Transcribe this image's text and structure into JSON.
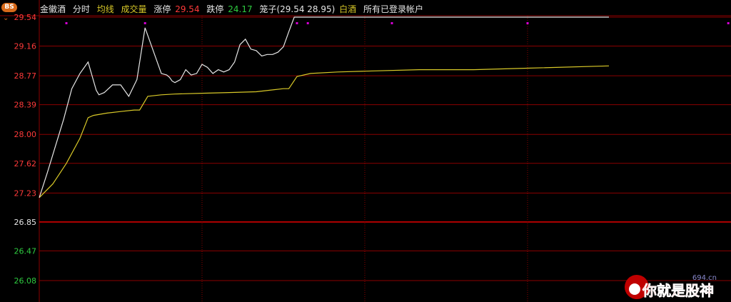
{
  "header": {
    "bs_badge": "BS",
    "stock_name": "金徽酒",
    "tab_timeshare": "分时",
    "tab_avg_line": "均线",
    "tab_volume": "成交量",
    "limit_up_label": "涨停",
    "limit_up_value": "29.54",
    "limit_down_label": "跌停",
    "limit_down_value": "24.17",
    "basket_text": "笼子(29.54 28.95)",
    "category": "白酒",
    "accounts_text": "所有已登录帐户"
  },
  "colors": {
    "background": "#000000",
    "grid": "#8b0000",
    "grid_center": "#b30000",
    "price_line": "#e6e6e6",
    "avg_line": "#d9c928",
    "up_text": "#ff3a3a",
    "down_text": "#2ecc40",
    "neutral_text": "#e6e6e6",
    "marker": "#d400d4"
  },
  "watermark": {
    "site": "694.cn",
    "text": "你就是股神"
  },
  "chart_data": {
    "type": "line",
    "ylim": [
      26.08,
      29.54
    ],
    "prev_close": 26.85,
    "y_ticks": [
      "29.54",
      "29.16",
      "28.77",
      "28.39",
      "28.00",
      "27.62",
      "27.23",
      "26.85",
      "26.47",
      "26.08"
    ],
    "session_minutes": 240,
    "series": [
      {
        "key": "price",
        "minutes": [
          0,
          3,
          6,
          9,
          12,
          15,
          18,
          21,
          22,
          24,
          27,
          30,
          33,
          36,
          39,
          42,
          45,
          47,
          48,
          49,
          50,
          52,
          54,
          56,
          58,
          60,
          62,
          64,
          66,
          68,
          70,
          72,
          74,
          76,
          78,
          80,
          82,
          84,
          86,
          88,
          90,
          92,
          94,
          95,
          96,
          97,
          98,
          99,
          100,
          101,
          102,
          103,
          104,
          105,
          106,
          107,
          108,
          210
        ],
        "values": [
          27.17,
          27.5,
          27.85,
          28.2,
          28.6,
          28.8,
          28.95,
          28.58,
          28.52,
          28.55,
          28.65,
          28.65,
          28.5,
          28.72,
          29.4,
          29.1,
          28.8,
          28.78,
          28.75,
          28.7,
          28.68,
          28.72,
          28.85,
          28.78,
          28.8,
          28.92,
          28.88,
          28.8,
          28.85,
          28.82,
          28.85,
          28.95,
          29.18,
          29.25,
          29.12,
          29.1,
          29.03,
          29.05,
          29.05,
          29.08,
          29.15,
          29.35,
          29.54,
          29.54,
          29.54,
          29.54,
          29.54,
          29.54,
          29.54,
          29.54,
          29.54,
          29.54,
          29.54,
          29.54,
          29.54,
          29.54,
          29.54,
          29.54
        ]
      },
      {
        "key": "average",
        "minutes": [
          0,
          5,
          10,
          15,
          18,
          20,
          25,
          30,
          35,
          37,
          40,
          45,
          50,
          60,
          70,
          80,
          90,
          92,
          95,
          100,
          110,
          120,
          140,
          160,
          180,
          210
        ],
        "values": [
          27.17,
          27.35,
          27.62,
          27.95,
          28.22,
          28.25,
          28.28,
          28.3,
          28.32,
          28.32,
          28.5,
          28.52,
          28.53,
          28.54,
          28.55,
          28.56,
          28.6,
          28.6,
          28.76,
          28.8,
          28.82,
          28.83,
          28.85,
          28.85,
          28.87,
          28.9
        ]
      }
    ],
    "markers": [
      10,
      39,
      95,
      99,
      130,
      180,
      254
    ],
    "vertical_grid_minutes": [
      60,
      120,
      180
    ]
  }
}
